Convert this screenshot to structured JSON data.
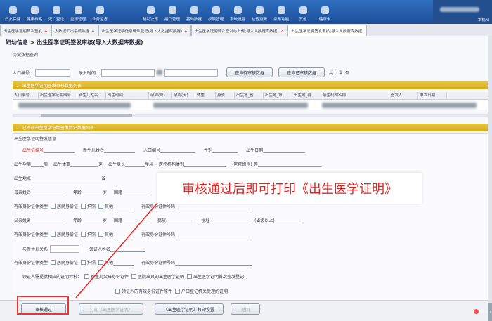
{
  "toolbar": {
    "left_items": [
      "妇女保健",
      "健康档案",
      "死亡登记",
      "重精管理",
      "业务监督"
    ],
    "mid_items": [
      "辅助决策",
      "接口管理",
      "基础数据",
      "权限管理",
      "系统设置",
      "检查更新",
      "常用功能",
      "其他",
      "健康卡"
    ],
    "user_label": "本机网"
  },
  "tabs": [
    {
      "label": "出生医学证明首次签发"
    },
    {
      "label": "大数据汇出手机数据"
    },
    {
      "label": "出生医学证明信息确认登记(导入大数据库数据)"
    },
    {
      "label": "出生医学证明首次签发与上传(导入大数据库数据)"
    },
    {
      "label": "出生医学证明签发审核(导入大数据库数据)",
      "active": true
    }
  ],
  "breadcrumb": "妇幼信息 > 出生医学证明签发审核(导入大数据库数据)",
  "query": {
    "section_label": "历史数据查询",
    "id_label": "人口编号：",
    "time_label": "录入时间：",
    "btn_pending": "查询待审核数据",
    "btn_approved": "查询已审核数据",
    "count_label": "共：",
    "count_value": "1",
    "count_unit": "条"
  },
  "pending_header": "出生医学证明签发审核数据列表",
  "table_columns": [
    "人口编号",
    "出生医学证明编号",
    "新生儿姓名",
    "出生时间",
    "孕周(周)",
    "孕周(天)",
    "体重",
    "身长",
    "出生地_省",
    "出生地_市",
    "出生地_县",
    "接生机构名称",
    "签发人",
    "申发日期"
  ],
  "approved_header": "已审核出生医学证明签发历史数据列表",
  "form": {
    "title": "出生医学证明签发信息",
    "row1": {
      "cert_no": "出生证编号",
      "name": "新生儿姓名",
      "pop_no": "人口编号",
      "sex": "性别",
      "birth_date": "出生日期"
    },
    "row2": {
      "gest": "出生孕周",
      "week": "周",
      "weight": "出生体重",
      "gram": "克",
      "length": "出生身长",
      "cm": "厘米",
      "inst_type": "医疗机构类别",
      "inst_level": "(医院级别)  等"
    },
    "row3": {
      "birthplace": "出生地点",
      "province": "省"
    },
    "row4": {
      "mother_name": "母亲姓名",
      "age": "年龄",
      "age_unit": "岁",
      "nationality": "国籍"
    },
    "row5": {
      "id_type": "有效身份证件类型",
      "opt1": "居民身份证",
      "opt2": "护照",
      "opt3": "其他",
      "id_no": "有效身份证件号码"
    },
    "row6": {
      "father_name": "父亲姓名",
      "age": "年龄",
      "age_unit": "岁",
      "nationality": "国籍",
      "ethnicity": "民族",
      "address": "住址",
      "addr_note": "(省级以上)"
    },
    "row7": {
      "id_type": "有效身份证件类型",
      "opt1": "居民身份证",
      "opt2": "护照",
      "opt3": "其他",
      "id_no": "有效身份证件号码"
    },
    "row8": {
      "relation": "与新生儿关系",
      "receiver": "领证人姓名"
    },
    "row9": {
      "id_type": "有效身份证件类型",
      "opt1": "居民身份证",
      "opt2": "护照",
      "opt3": "其他",
      "id_no": "有效身份证件号码"
    },
    "row10": {
      "materials": "领证人需提供相应的证明材料：",
      "m1": "新生儿父母身份证件",
      "m2": "医院出具的出生医学证明",
      "m3": "出生医学证明首次签发登记",
      "m4": "领证人的有效身份证件原件",
      "m5": "户口登记机关受理的证明"
    }
  },
  "annotation": "审核通过后即可打印《出生医学证明》",
  "bottom": {
    "approve_btn": "审核通过",
    "print_btn": "打印《出生医学证明》",
    "print_settings_btn": "《出生医学证明》打印设置",
    "other_btn": "返回"
  },
  "taskbar": "中 ∘ ∘"
}
